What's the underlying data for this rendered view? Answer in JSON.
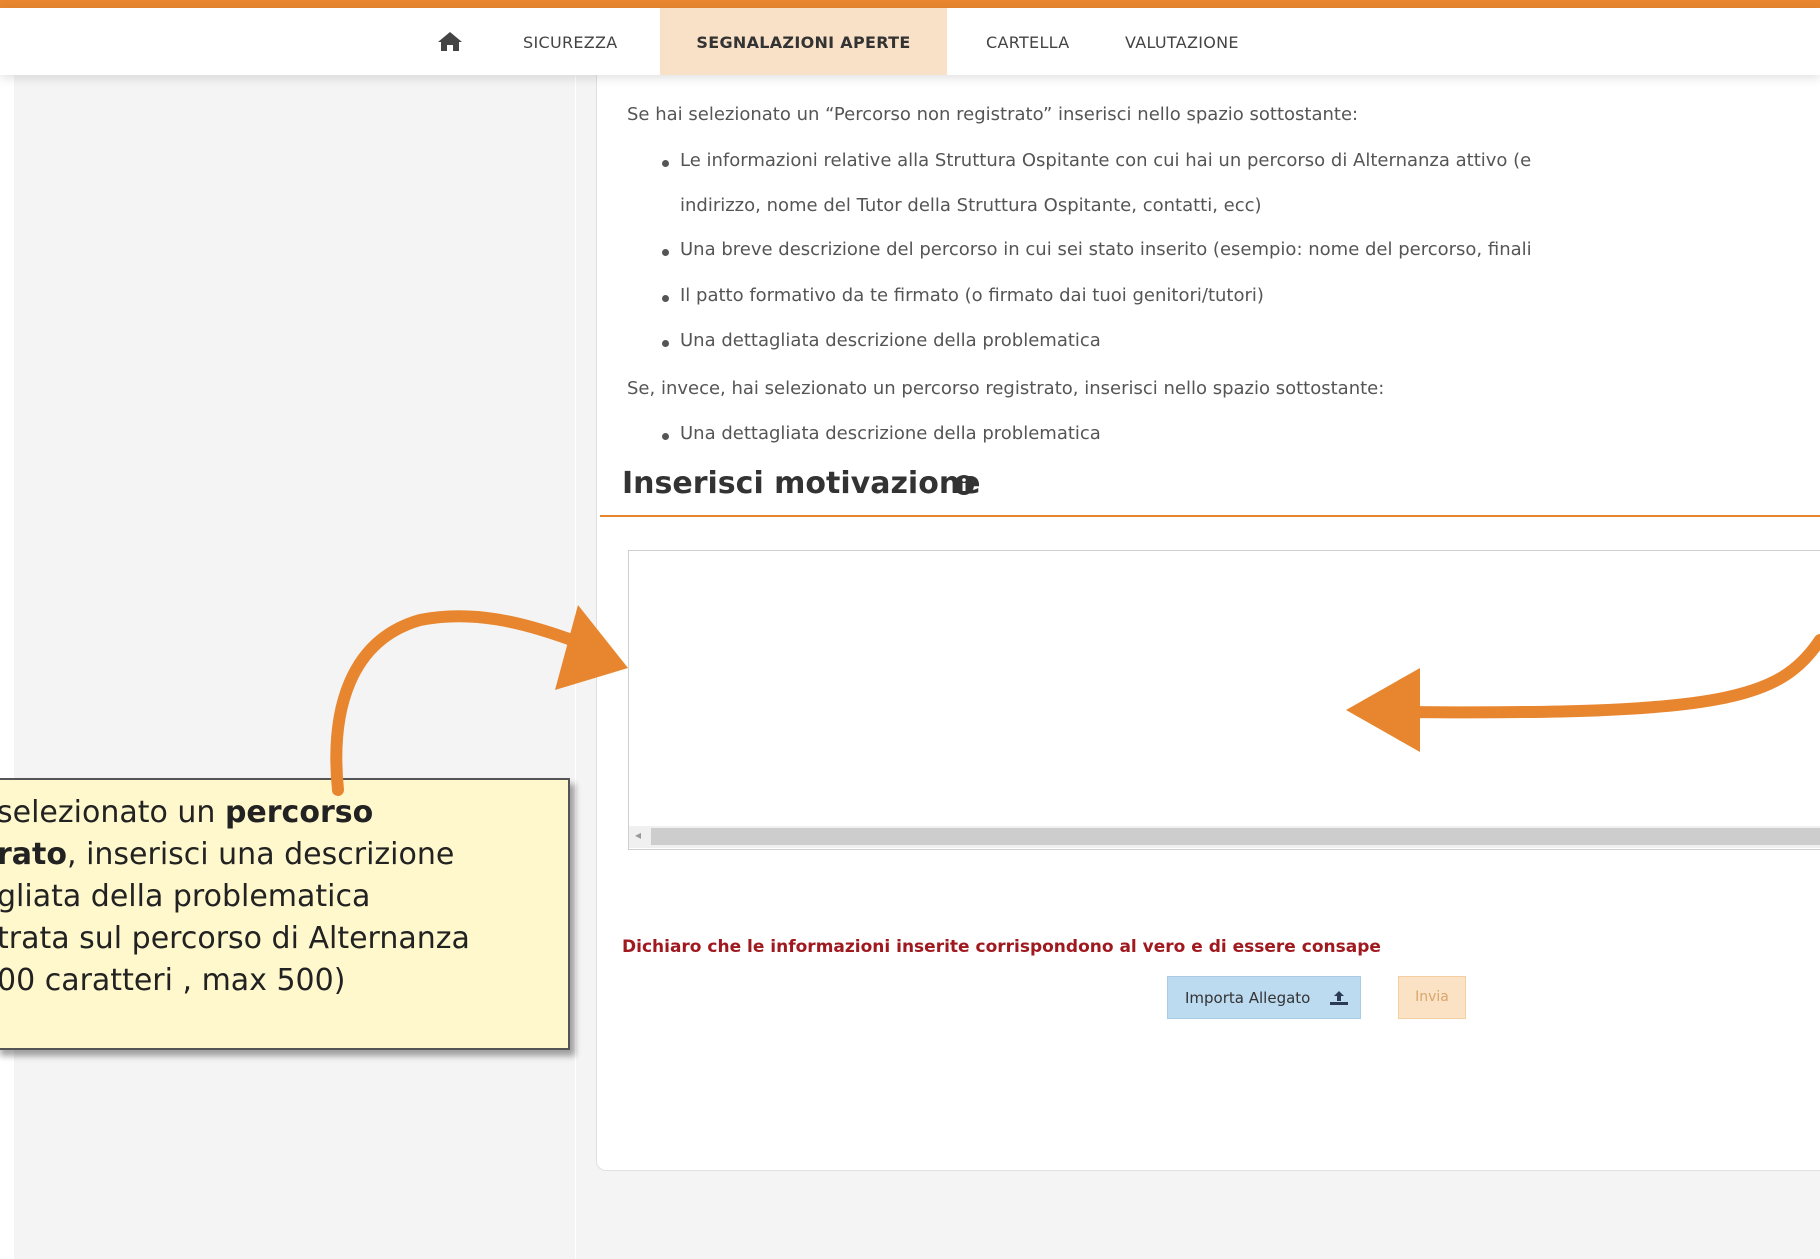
{
  "nav": {
    "tabs": [
      {
        "label": "SICUREZZA"
      },
      {
        "label": "SEGNALAZIONI APERTE"
      },
      {
        "label": "CARTELLA"
      },
      {
        "label": "VALUTAZIONE"
      }
    ],
    "active_tab": "SEGNALAZIONI APERTE"
  },
  "instructions": {
    "intro_unregistered": "Se hai selezionato un “Percorso non registrato” inserisci nello spazio sottostante:",
    "bullets_unregistered": [
      "Le informazioni relative alla Struttura Ospitante con cui hai un percorso di Alternanza attivo (e",
      "indirizzo, nome del Tutor della Struttura Ospitante, contatti, ecc)",
      "Una breve descrizione del percorso in cui sei stato inserito (esempio: nome del percorso, finali",
      "Il patto formativo da te firmato (o firmato dai tuoi genitori/tutori)",
      "Una dettagliata descrizione della problematica"
    ],
    "intro_registered": "Se, invece, hai selezionato un percorso registrato, inserisci nello spazio sottostante:",
    "bullets_registered": [
      "Una dettagliata descrizione della problematica"
    ]
  },
  "section": {
    "title": "Inserisci motivazione"
  },
  "textarea": {
    "value": ""
  },
  "declaration": "Dichiaro che le informazioni inserite corrispondono al vero e di essere consape",
  "buttons": {
    "import_label": "Importa Allegato",
    "send_label": "Invia"
  },
  "callout": {
    "line1_pre": "selezionato un ",
    "line1_bold": "percorso",
    "line2_bold": "rato",
    "line2_rest": ", inserisci una descrizione",
    "line3": "gliata della problematica",
    "line4": "trata sul percorso di Alternanza",
    "line5": "00 caratteri , max 500)"
  },
  "colors": {
    "accent": "#e8862f",
    "active_tab_bg": "#f9e1c8",
    "declaration_text": "#a0191f",
    "import_button_bg": "#bcdaf0",
    "send_button_bg": "#fbe2c4",
    "callout_bg": "#fff8cc"
  },
  "icons": [
    "home-icon",
    "info-icon",
    "upload-icon",
    "arrow-annotation-icon"
  ]
}
